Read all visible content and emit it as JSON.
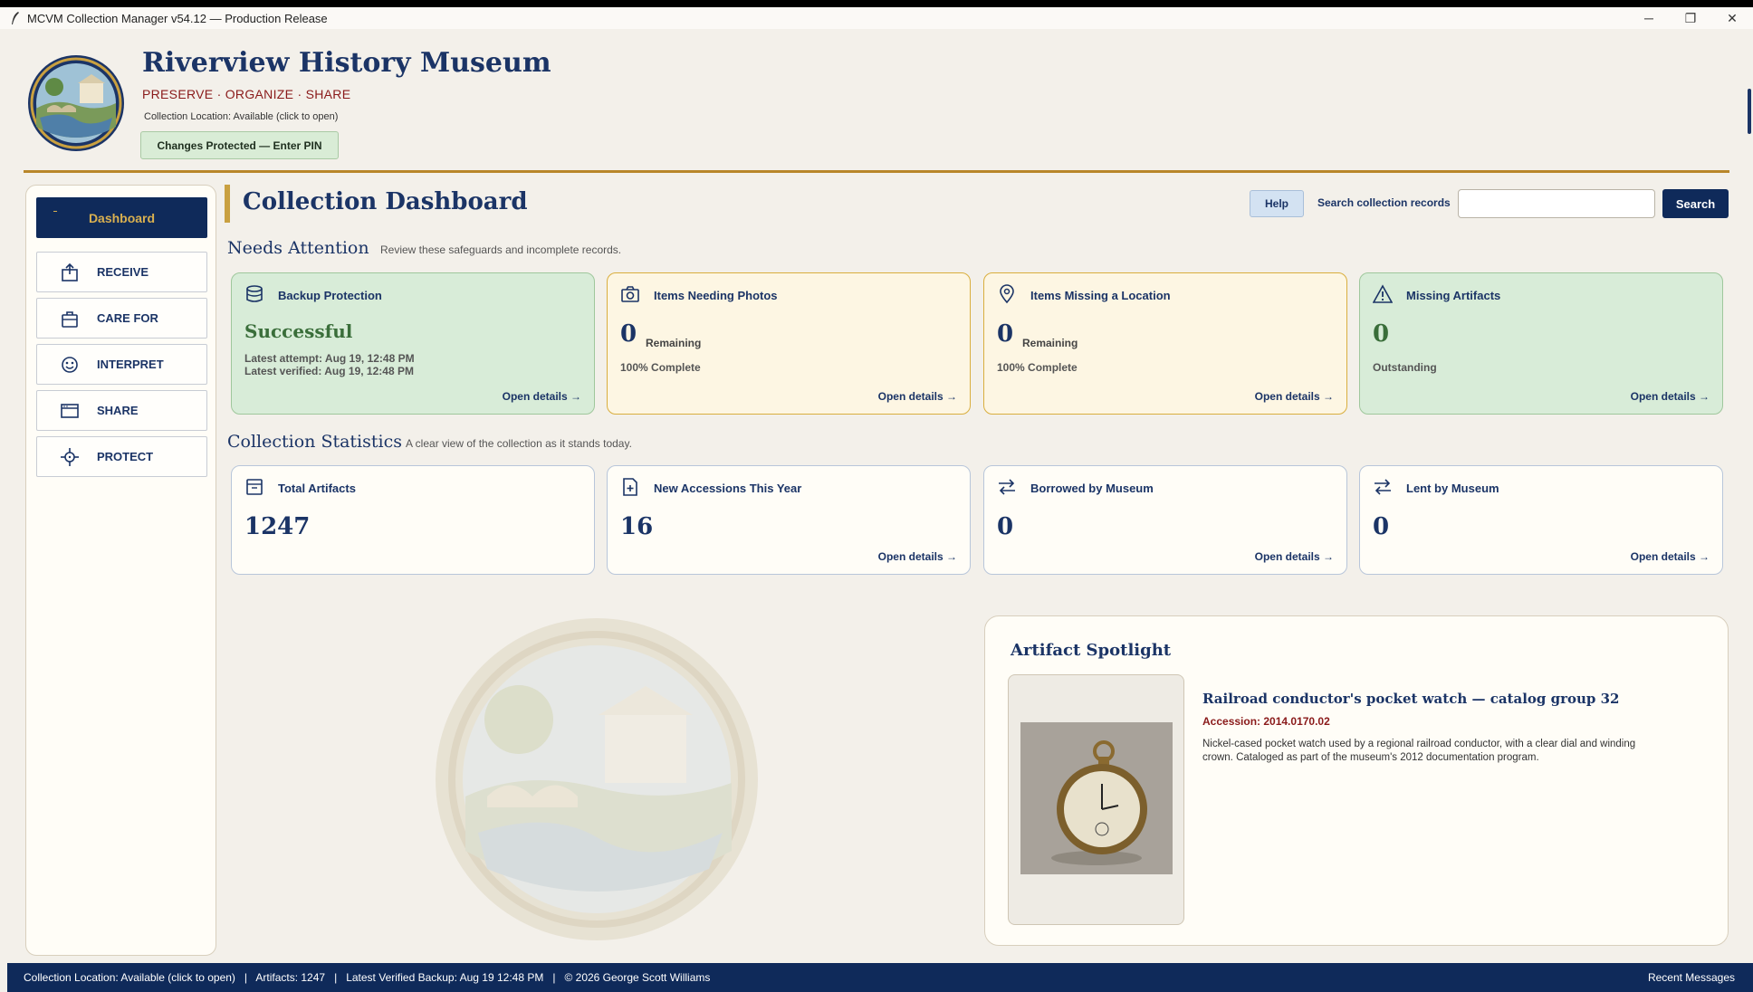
{
  "window": {
    "title": "MCVM Collection Manager v54.12 — Production Release",
    "minimize": "─",
    "restore": "❐",
    "close": "✕"
  },
  "header": {
    "museum_name": "Riverview History Museum",
    "tagline": "PRESERVE · ORGANIZE · SHARE",
    "collection_location": "Collection Location: Available (click to open)",
    "pin_button": "Changes Protected — Enter PIN"
  },
  "sidebar": {
    "items": [
      {
        "label": "Dashboard",
        "icon": "dashboard-icon",
        "active": true
      },
      {
        "label": "RECEIVE",
        "icon": "receive-box-icon"
      },
      {
        "label": "CARE FOR",
        "icon": "care-bag-icon"
      },
      {
        "label": "INTERPRET",
        "icon": "face-icon"
      },
      {
        "label": "SHARE",
        "icon": "window-icon"
      },
      {
        "label": "PROTECT",
        "icon": "crosshair-icon"
      }
    ]
  },
  "main": {
    "title": "Collection Dashboard",
    "help": "Help",
    "search_label": "Search collection records",
    "search_value": "",
    "search_button": "Search"
  },
  "needs_attention": {
    "title": "Needs Attention",
    "subtitle": "Review these safeguards and incomplete records.",
    "cards": [
      {
        "title": "Backup Protection",
        "status": "Successful",
        "line1": "Latest attempt: Aug 19, 12:48 PM",
        "line2": "Latest verified: Aug 19, 12:48 PM",
        "open": "Open details →",
        "icon": "database-icon"
      },
      {
        "title": "Items Needing Photos",
        "value": "0",
        "unit": "Remaining",
        "note": "100% Complete",
        "open": "Open details →",
        "icon": "camera-icon"
      },
      {
        "title": "Items Missing a Location",
        "value": "0",
        "unit": "Remaining",
        "note": "100% Complete",
        "open": "Open details →",
        "icon": "map-pin-icon"
      },
      {
        "title": "Missing Artifacts",
        "value": "0",
        "note": "Outstanding",
        "open": "Open details →",
        "icon": "warning-icon"
      }
    ]
  },
  "statistics": {
    "title": "Collection Statistics",
    "subtitle": "A clear view of the collection as it stands today.",
    "cards": [
      {
        "title": "Total Artifacts",
        "value": "1247",
        "icon": "archive-box-icon"
      },
      {
        "title": "New Accessions This Year",
        "value": "16",
        "open": "Open details →",
        "icon": "file-plus-icon"
      },
      {
        "title": "Borrowed by Museum",
        "value": "0",
        "open": "Open details →",
        "icon": "swap-arrows-icon"
      },
      {
        "title": "Lent by Museum",
        "value": "0",
        "open": "Open details →",
        "icon": "swap-arrows-icon"
      }
    ]
  },
  "spotlight": {
    "title": "Artifact Spotlight",
    "artifact_title": "Railroad conductor's pocket watch — catalog group 32",
    "accession": "Accession: 2014.0170.02",
    "description": "Nickel-cased pocket watch used by a regional railroad conductor, with a clear dial and winding crown. Cataloged as part of the museum's 2012 documentation program."
  },
  "statusbar": {
    "left": "Collection Location: Available (click to open)   |   Artifacts: 1247   |   Latest Verified Backup: Aug 19 12:48 PM   |   © 2026 George Scott Williams",
    "right": "Recent Messages"
  },
  "colors": {
    "navy": "#0f2a5a",
    "gold": "#b8862a",
    "green_card": "#d8ecd8",
    "amber_card": "#fdf6e3",
    "maroon": "#8a1a1a"
  }
}
